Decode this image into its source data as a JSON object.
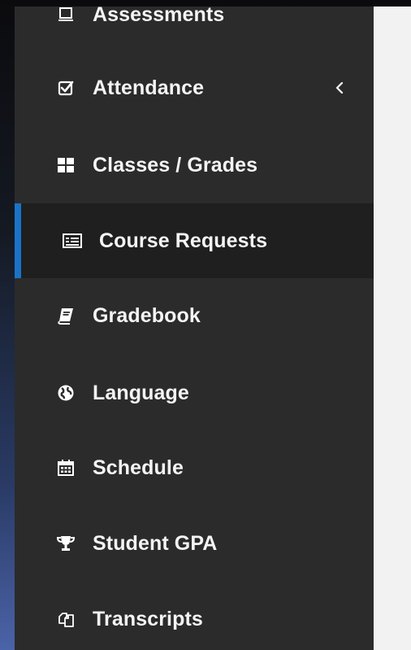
{
  "nav": {
    "items": [
      {
        "label": "Assessments",
        "icon": "monitor-icon"
      },
      {
        "label": "Attendance",
        "icon": "checkbox-icon",
        "has_submenu": true
      },
      {
        "label": "Classes / Grades",
        "icon": "grid-icon"
      },
      {
        "label": "Course Requests",
        "icon": "list-icon",
        "active": true
      },
      {
        "label": "Gradebook",
        "icon": "book-icon"
      },
      {
        "label": "Language",
        "icon": "globe-icon"
      },
      {
        "label": "Schedule",
        "icon": "calendar-icon"
      },
      {
        "label": "Student GPA",
        "icon": "trophy-icon"
      },
      {
        "label": "Transcripts",
        "icon": "copy-icon"
      }
    ]
  },
  "colors": {
    "sidebar_bg": "#2b2b2b",
    "active_bg": "#1f1f1f",
    "active_accent": "#1a73c9",
    "content_bg": "#f2f2f2",
    "text": "#f4f4f4"
  }
}
